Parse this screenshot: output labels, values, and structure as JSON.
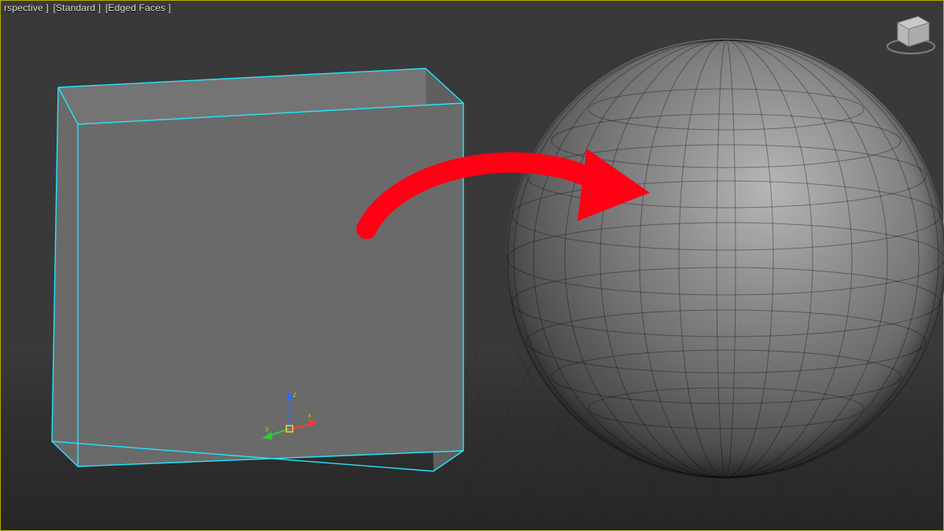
{
  "viewport": {
    "labels": [
      "rspective ]",
      "[Standard ]",
      "[Edged Faces ]"
    ]
  },
  "gizmo": {
    "z": "z",
    "x": "x",
    "y": "y"
  },
  "objects": {
    "cube": {
      "selected": true
    },
    "sphere": {
      "selected": false
    }
  },
  "annotation": {
    "kind": "arrow",
    "color": "#ff0014"
  }
}
